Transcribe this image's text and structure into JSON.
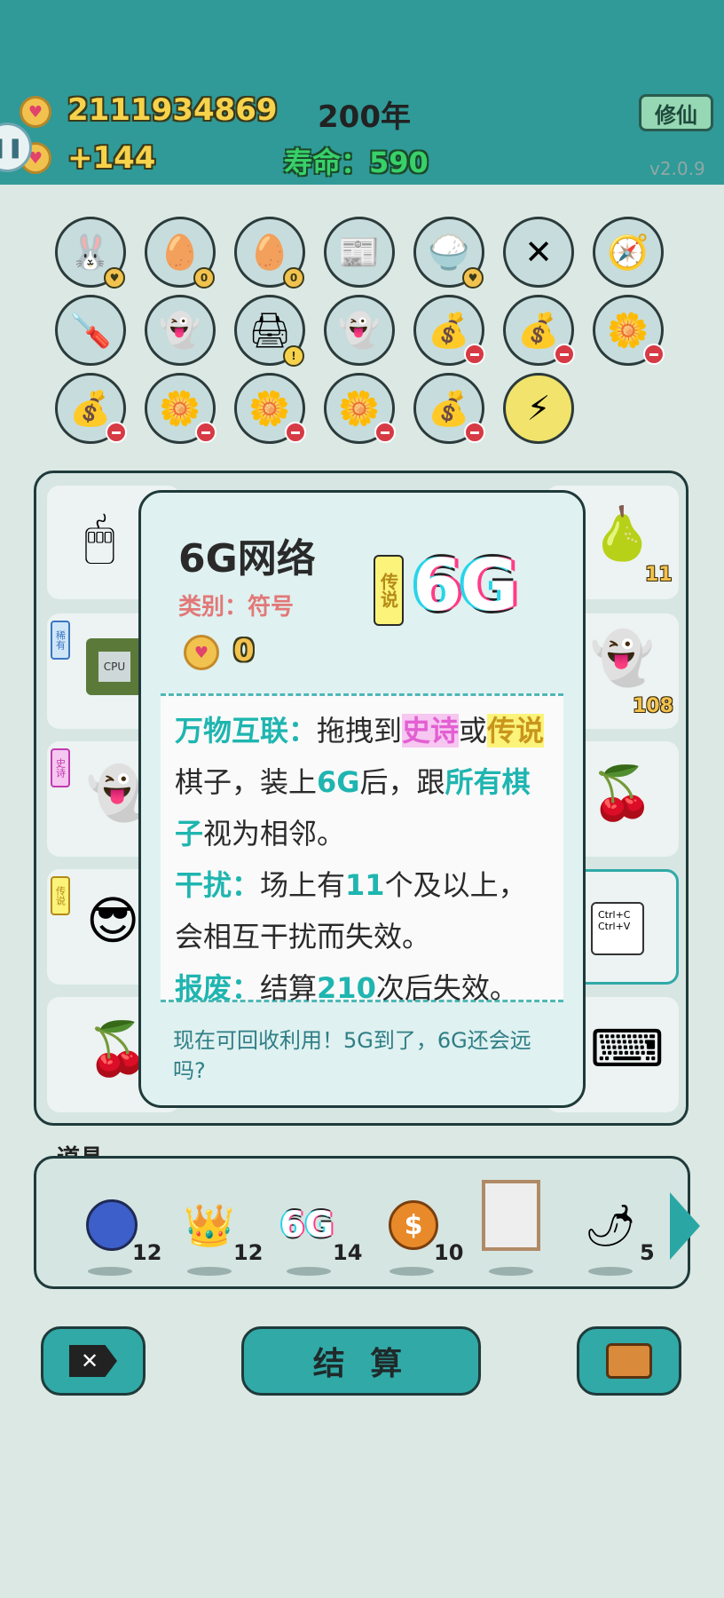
{
  "header": {
    "gold": "2111934869",
    "gold_rate": "+144",
    "year": "200年",
    "life_label": "寿命：",
    "life_value": "590",
    "cultivate_button": "修仙",
    "version": "v2.0.9",
    "pause_icon": "pause-icon"
  },
  "inventory": {
    "items": [
      {
        "icon": "rabbit-icon",
        "badge": "coin"
      },
      {
        "icon": "egg-tray-icon",
        "badge": "0"
      },
      {
        "icon": "egg-tray-icon",
        "badge": "0"
      },
      {
        "icon": "time-magazine-icon",
        "badge": ""
      },
      {
        "icon": "rice-bowl-icon",
        "badge": "coin"
      },
      {
        "icon": "crossed-sticks-icon",
        "badge": ""
      },
      {
        "icon": "compass-icon",
        "badge": ""
      },
      {
        "icon": "screwdriver-icon",
        "badge": ""
      },
      {
        "icon": "ghost-icon",
        "badge": ""
      },
      {
        "icon": "printer-icon",
        "badge": "warning"
      },
      {
        "icon": "ghost-wink-icon",
        "badge": ""
      },
      {
        "icon": "sack-icon",
        "badge": "remove"
      },
      {
        "icon": "sack-icon",
        "badge": "remove"
      },
      {
        "icon": "flower-pot-icon",
        "badge": "remove"
      },
      {
        "icon": "sack-icon",
        "badge": "remove"
      },
      {
        "icon": "flower-pot-icon",
        "badge": "remove"
      },
      {
        "icon": "flower-pot-icon",
        "badge": "remove"
      },
      {
        "icon": "flower-pot-icon",
        "badge": "remove"
      },
      {
        "icon": "sack-icon",
        "badge": "remove"
      },
      {
        "icon": "lightning-icon",
        "badge": ""
      }
    ]
  },
  "board": {
    "tags": [
      "稀有",
      "史诗",
      "传说"
    ],
    "counts": [
      "11",
      "108"
    ],
    "pieces": [
      "mouse-icon",
      "pear-icon",
      "cpu-icon",
      "ghost-icon",
      "ghost-icon",
      "cherry-icon",
      "face-icon",
      "copy-paste-icon",
      "cherry-icon",
      "keyboard-icon"
    ],
    "cpu_label": "CPU",
    "copy_label": "Ctrl+C",
    "paste_label": "Ctrl+V"
  },
  "popup": {
    "title": "6G网络",
    "category": "类别：符号",
    "price": "0",
    "rarity": "传说",
    "big_icon_text": "6G",
    "desc": {
      "k1": "万物互联：",
      "t1a": "拖拽到",
      "epic": "史诗",
      "t1b": "或",
      "legend": "传说",
      "t1c": "棋子，装上",
      "k6g": "6G",
      "t1d": "后，跟",
      "kall": "所有棋子",
      "t1e": "视为相邻。",
      "k2": "干扰：",
      "t2a": "场上有",
      "n11": "11",
      "t2b": "个及以上，会相互干扰而失效。",
      "k3": "报废：",
      "t3a": "结算",
      "n210": "210",
      "t3b": "次后失效。"
    },
    "flavor": "现在可回收利用！5G到了，6G还会远吗?"
  },
  "props": {
    "label": "道具",
    "items": [
      {
        "icon": "blueberry-icon",
        "count": "12"
      },
      {
        "icon": "crown-icon",
        "count": "12"
      },
      {
        "icon": "6g-icon",
        "count": "14",
        "text": "6G"
      },
      {
        "icon": "dollar-coin-icon",
        "count": "10"
      },
      {
        "icon": "remote-frame-icon",
        "count": ""
      },
      {
        "icon": "chili-icon",
        "count": "5"
      }
    ]
  },
  "buttons": {
    "settle": "结 算",
    "delete_icon": "delete-icon",
    "bag_icon": "briefcase-icon"
  }
}
